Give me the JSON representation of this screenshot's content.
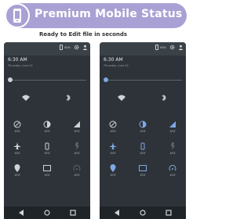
{
  "banner": {
    "title": "Premium Mobile Status bar",
    "badge_icon": "mobile-phone-icon"
  },
  "subtitle": "Ready to Edit file in seconds",
  "colors": {
    "banner": "#a9a1d4",
    "panel": "#2d3338",
    "accent_left": "#cfd3d6",
    "accent_right": "#7fa8e6"
  },
  "statusbar": {
    "battery": "80%"
  },
  "clock": {
    "time": "6:30 AM",
    "date": "Thursday, June 22"
  },
  "tiles": {
    "row1": [
      "",
      ""
    ],
    "row2": [
      "XYZ",
      "XYZ",
      "XYZ"
    ],
    "row3": [
      "XYZ",
      "XYZ",
      "XYZ"
    ],
    "row4": [
      "XYZ",
      "XYZ",
      "XYZ"
    ]
  },
  "nav": [
    "back-icon",
    "home-icon",
    "recents-icon"
  ]
}
